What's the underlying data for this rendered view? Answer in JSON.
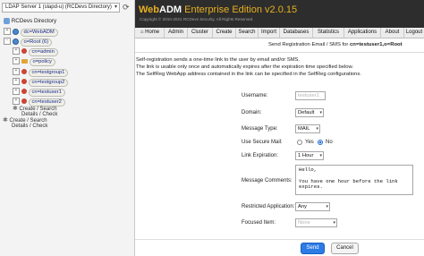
{
  "left": {
    "server": "LDAP Server 1 (slapd-u) (RCDevs Directory)",
    "tree": [
      {
        "label": "RCDevs Directory"
      },
      {
        "label": "dc=WebADM"
      },
      {
        "label": "o=Root (6)"
      },
      {
        "label": "cn=admin"
      },
      {
        "label": "o=policy"
      },
      {
        "label": "cn=testgroup1"
      },
      {
        "label": "cn=testgroup2"
      },
      {
        "label": "cn=testuser1"
      },
      {
        "label": "cn=testuser2"
      }
    ],
    "link1_line1": "Create / Search",
    "link1_line2": "Details / Check",
    "link2_line1": "Create / Search",
    "link2_line2": "Details / Check"
  },
  "header": {
    "brand_web": "Web",
    "brand_adm": "ADM",
    "brand_rest": " Enterprise Edition v2.0.15",
    "copyright": "Copyright © 2010-2021 RCDevs Security. All Rights Reserved."
  },
  "nav": [
    "Home",
    "Admin",
    "Cluster",
    "Create",
    "Search",
    "Import",
    "Databases",
    "Statistics",
    "Applications",
    "About",
    "Logout"
  ],
  "page": {
    "subtitle_prefix": "Send Registration Email / SMS for ",
    "subtitle_target": "cn=testuser1,o=Root",
    "info": [
      "Self-registration sends a one-time link to the user by email and/or SMS.",
      "The link is usable only once and automatically expires after the expiration time specified below.",
      "The SelfReg WebApp address contained in the link can be specified in the SelfReg configurations."
    ]
  },
  "form": {
    "username_label": "Username:",
    "username_value": "testuser1",
    "domain_label": "Domain:",
    "domain_value": "Default",
    "message_type_label": "Message Type:",
    "message_type_value": "MAIL",
    "secure_mail_label": "Use Secure Mail:",
    "secure_yes": "Yes",
    "secure_no": "No",
    "secure_selected": "No",
    "link_expiration_label": "Link Expiration:",
    "link_expiration_value": "1 Hour",
    "comments_label": "Message Comments:",
    "comments_value": "Hello,\n\nYou have one hour before the link\nexpires.",
    "restricted_app_label": "Restricted Application:",
    "restricted_app_value": "Any",
    "focused_item_label": "Focused Item:",
    "focused_item_placeholder": "None",
    "send_label": "Send",
    "cancel_label": "Cancel"
  },
  "colors": {
    "header_bg": "#2d2d2d",
    "brand": "#e8b020",
    "send_button": "#2d7be5",
    "tree_node": "#1a2a8a"
  }
}
